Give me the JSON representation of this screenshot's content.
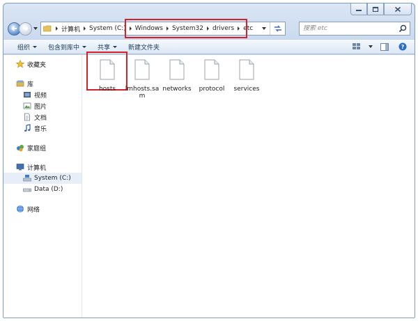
{
  "window": {
    "accent": "#d3222a"
  },
  "address": {
    "crumbs": [
      "计算机",
      "System (C:)",
      "Windows",
      "System32",
      "drivers",
      "etc"
    ]
  },
  "search": {
    "placeholder": "搜索 etc"
  },
  "toolbar": {
    "organize": "组织",
    "include_in_library": "包含到库中",
    "share": "共享",
    "new_folder": "新建文件夹"
  },
  "sidebar": {
    "favorites": "收藏夹",
    "libraries": "库",
    "library_items": [
      "视频",
      "图片",
      "文档",
      "音乐"
    ],
    "homegroup": "家庭组",
    "computer": "计算机",
    "drives": [
      "System (C:)",
      "Data (D:)"
    ],
    "network": "网络"
  },
  "files": [
    "hosts",
    "lmhosts.sam",
    "networks",
    "protocol",
    "services"
  ]
}
